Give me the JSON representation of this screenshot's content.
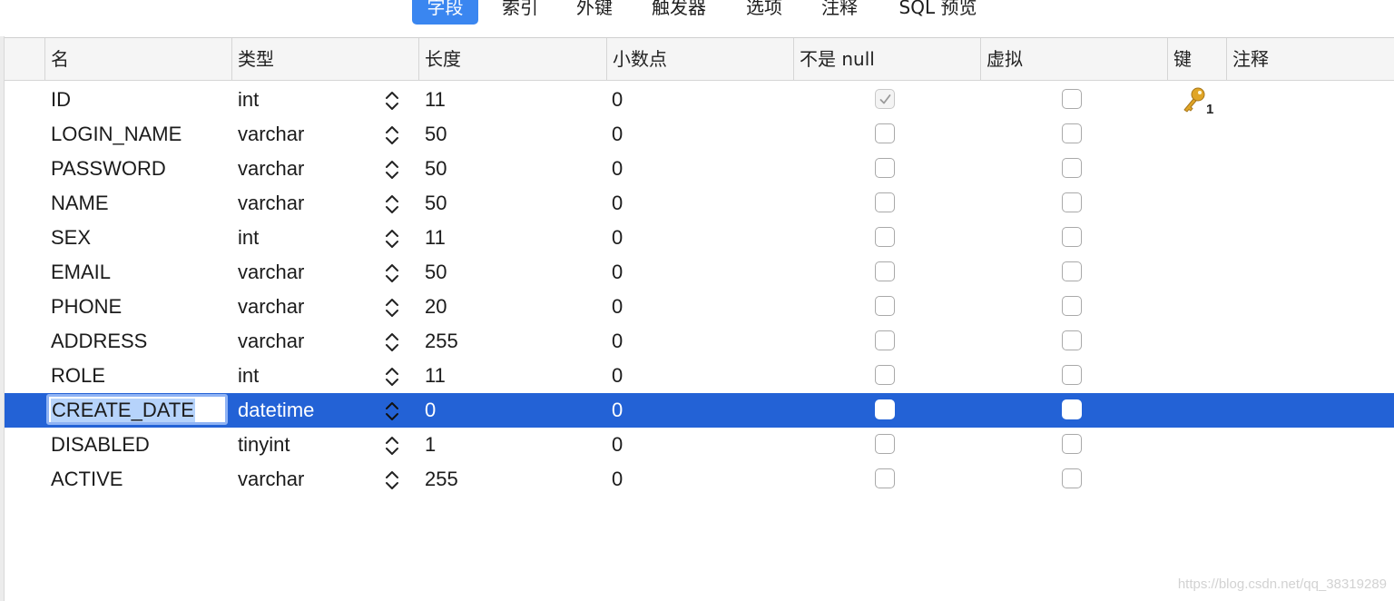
{
  "tabs": [
    {
      "label": "字段",
      "active": true
    },
    {
      "label": "索引",
      "active": false
    },
    {
      "label": "外键",
      "active": false
    },
    {
      "label": "触发器",
      "active": false
    },
    {
      "label": "选项",
      "active": false
    },
    {
      "label": "注释",
      "active": false
    },
    {
      "label": "SQL 预览",
      "active": false
    }
  ],
  "columns": {
    "name": "名",
    "type": "类型",
    "length": "长度",
    "decimals": "小数点",
    "not_null": "不是 null",
    "virtual": "虚拟",
    "key": "键",
    "comment": "注释"
  },
  "rows": [
    {
      "name": "ID",
      "type": "int",
      "length": "11",
      "decimals": "0",
      "not_null": true,
      "virtual": false,
      "key": "1"
    },
    {
      "name": "LOGIN_NAME",
      "type": "varchar",
      "length": "50",
      "decimals": "0",
      "not_null": false,
      "virtual": false
    },
    {
      "name": "PASSWORD",
      "type": "varchar",
      "length": "50",
      "decimals": "0",
      "not_null": false,
      "virtual": false
    },
    {
      "name": "NAME",
      "type": "varchar",
      "length": "50",
      "decimals": "0",
      "not_null": false,
      "virtual": false
    },
    {
      "name": "SEX",
      "type": "int",
      "length": "11",
      "decimals": "0",
      "not_null": false,
      "virtual": false
    },
    {
      "name": "EMAIL",
      "type": "varchar",
      "length": "50",
      "decimals": "0",
      "not_null": false,
      "virtual": false
    },
    {
      "name": "PHONE",
      "type": "varchar",
      "length": "20",
      "decimals": "0",
      "not_null": false,
      "virtual": false
    },
    {
      "name": "ADDRESS",
      "type": "varchar",
      "length": "255",
      "decimals": "0",
      "not_null": false,
      "virtual": false
    },
    {
      "name": "ROLE",
      "type": "int",
      "length": "11",
      "decimals": "0",
      "not_null": false,
      "virtual": false
    },
    {
      "name": "CREATE_DATE",
      "type": "datetime",
      "length": "0",
      "decimals": "0",
      "not_null": false,
      "virtual": false,
      "selected": true,
      "editing": true
    },
    {
      "name": "DISABLED",
      "type": "tinyint",
      "length": "1",
      "decimals": "0",
      "not_null": false,
      "virtual": false
    },
    {
      "name": "ACTIVE",
      "type": "varchar",
      "length": "255",
      "decimals": "0",
      "not_null": false,
      "virtual": false
    }
  ],
  "watermark": "https://blog.csdn.net/qq_38319289",
  "colors": {
    "accent": "#3a86f0",
    "selection": "#2362d6",
    "edit_highlight": "#b6d3fb",
    "key": "#e0a526"
  },
  "icons": {
    "key": "key-icon",
    "stepper": "up-down-stepper-icon",
    "check": "check-icon"
  }
}
